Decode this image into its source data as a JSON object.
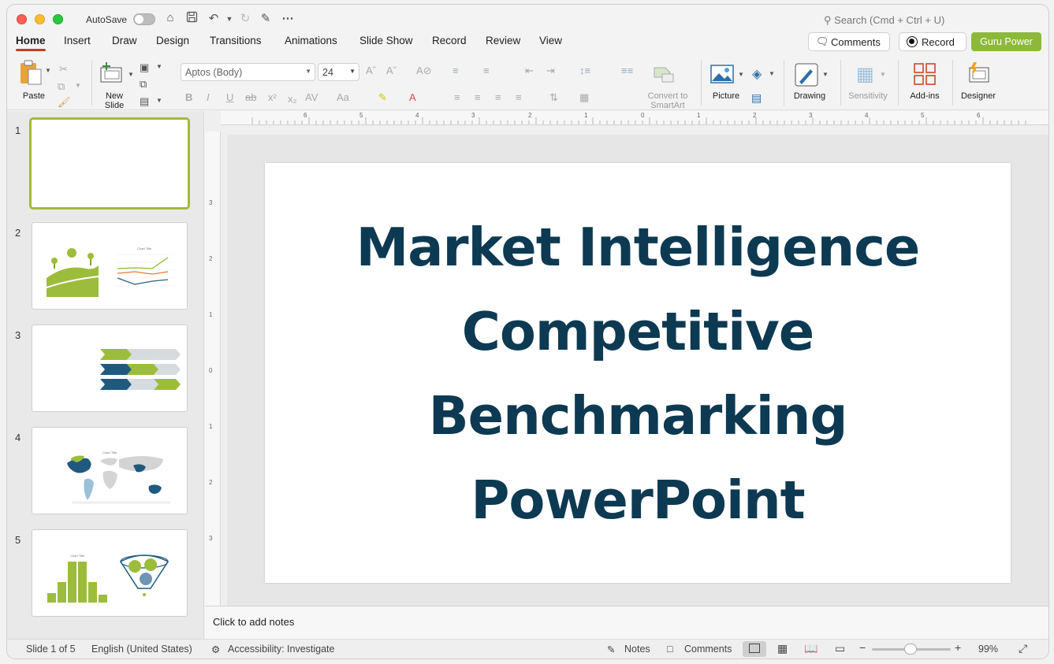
{
  "titlebar": {
    "autosave_label": "AutoSave",
    "search_placeholder": "Search (Cmd + Ctrl + U)"
  },
  "tabs": [
    "Home",
    "Insert",
    "Draw",
    "Design",
    "Transitions",
    "Animations",
    "Slide Show",
    "Record",
    "Review",
    "View"
  ],
  "header_buttons": {
    "comments": "Comments",
    "record": "Record",
    "guru": "Guru Power"
  },
  "ribbon": {
    "paste": "Paste",
    "new_slide_1": "New",
    "new_slide_2": "Slide",
    "font_name": "Aptos (Body)",
    "font_size": "24",
    "convert_1": "Convert to",
    "convert_2": "SmartArt",
    "picture": "Picture",
    "drawing": "Drawing",
    "sensitivity": "Sensitivity",
    "addins": "Add-ins",
    "designer": "Designer"
  },
  "thumbnails": [
    {
      "number": "1"
    },
    {
      "number": "2",
      "chart_title": "Chart Title"
    },
    {
      "number": "3"
    },
    {
      "number": "4",
      "chart_title": "Chart Title"
    },
    {
      "number": "5",
      "chart_title": "Chart Title"
    }
  ],
  "ruler": {
    "h": [
      "6",
      "5",
      "4",
      "3",
      "2",
      "1",
      "0",
      "1",
      "2",
      "3",
      "4",
      "5",
      "6"
    ],
    "v": [
      "3",
      "2",
      "1",
      "0",
      "1",
      "2",
      "3"
    ]
  },
  "slide": {
    "title_lines": [
      "Market Intelligence",
      "Competitive",
      "Benchmarking",
      "PowerPoint"
    ]
  },
  "notes_placeholder": "Click to add notes",
  "statusbar": {
    "slide_count": "Slide 1 of 5",
    "language": "English (United States)",
    "accessibility": "Accessibility: Investigate",
    "notes": "Notes",
    "comments": "Comments",
    "zoom": "99%"
  },
  "colors": {
    "title_color": "#0d3a52",
    "accent_green": "#8db83a",
    "active_tab_underline": "#c43e1c"
  }
}
